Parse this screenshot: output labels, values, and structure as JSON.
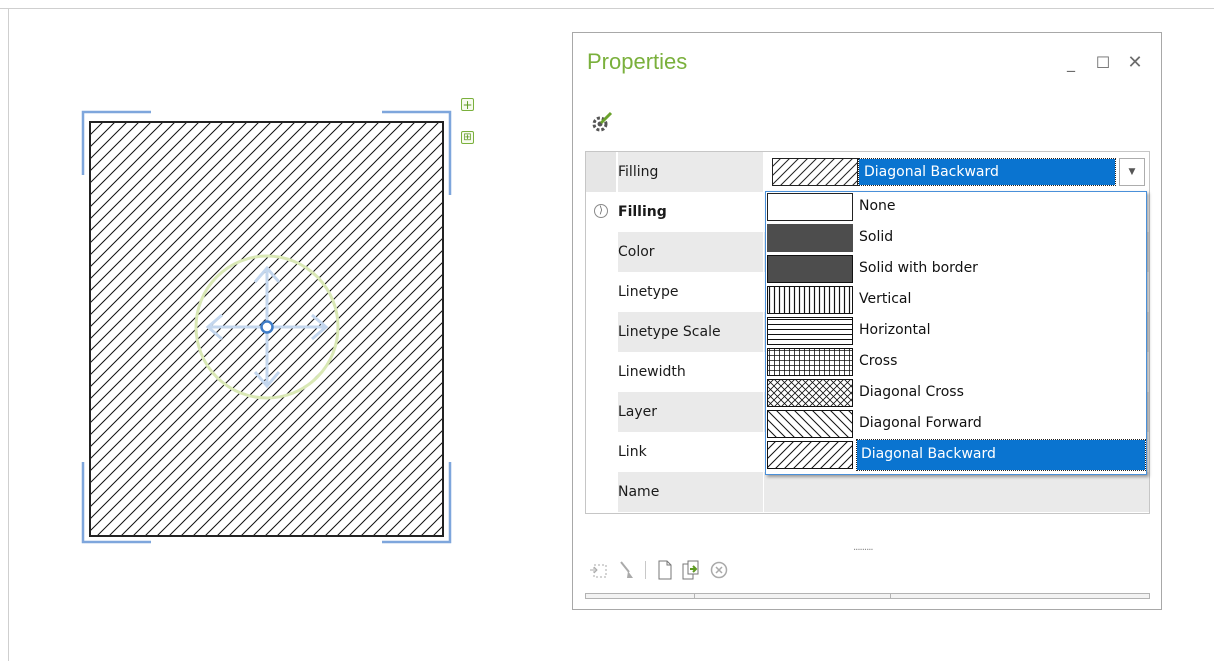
{
  "panel": {
    "title": "Properties",
    "minimize_glyph": "_",
    "maximize_glyph": "☐",
    "close_glyph": "✕"
  },
  "rows": [
    {
      "label": "Filling",
      "bold": false
    },
    {
      "label": "Filling",
      "bold": true
    },
    {
      "label": "Color",
      "bold": false
    },
    {
      "label": "Linetype",
      "bold": false
    },
    {
      "label": "Linetype Scale",
      "bold": false
    },
    {
      "label": "Linewidth",
      "bold": false
    },
    {
      "label": "Layer",
      "bold": false
    },
    {
      "label": "Link",
      "bold": false
    },
    {
      "label": "Name",
      "bold": false
    }
  ],
  "combo": {
    "selected": "Diagonal Backward",
    "arrow_glyph": "▼"
  },
  "dropdown": {
    "items": [
      {
        "label": "None",
        "pattern": "none"
      },
      {
        "label": "Solid",
        "pattern": "solid"
      },
      {
        "label": "Solid with border",
        "pattern": "solid-border"
      },
      {
        "label": "Vertical",
        "pattern": "vertical"
      },
      {
        "label": "Horizontal",
        "pattern": "horizontal"
      },
      {
        "label": "Cross",
        "pattern": "cross"
      },
      {
        "label": "Diagonal Cross",
        "pattern": "diagonal-cross"
      },
      {
        "label": "Diagonal Forward",
        "pattern": "diagonal-forward"
      },
      {
        "label": "Diagonal Backward",
        "pattern": "diagonal-backward"
      }
    ],
    "selected_index": 8
  },
  "colors": {
    "accent_green": "#7ab03c",
    "selection_blue": "#0a74d0",
    "handle_blue": "#7ea6dc",
    "solid_fill": "#4d4d4d"
  },
  "add_buttons": [
    "+",
    "⊞"
  ]
}
